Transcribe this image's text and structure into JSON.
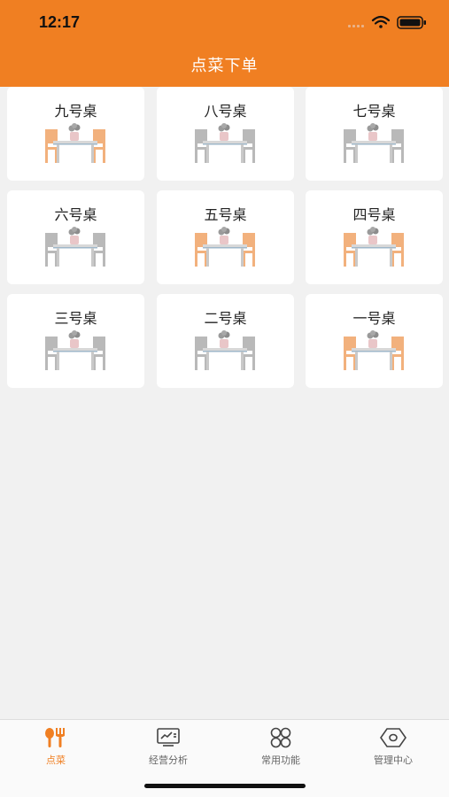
{
  "status": {
    "time": "12:17"
  },
  "header": {
    "title": "点菜下单"
  },
  "tables": [
    {
      "label": "九号桌",
      "occupied": true
    },
    {
      "label": "八号桌",
      "occupied": false
    },
    {
      "label": "七号桌",
      "occupied": false
    },
    {
      "label": "六号桌",
      "occupied": false
    },
    {
      "label": "五号桌",
      "occupied": true
    },
    {
      "label": "四号桌",
      "occupied": true
    },
    {
      "label": "三号桌",
      "occupied": false
    },
    {
      "label": "二号桌",
      "occupied": false
    },
    {
      "label": "一号桌",
      "occupied": true
    }
  ],
  "tabbar": {
    "items": [
      {
        "label": "点菜",
        "icon": "fork-spoon-icon",
        "active": true
      },
      {
        "label": "经营分析",
        "icon": "chart-monitor-icon",
        "active": false
      },
      {
        "label": "常用功能",
        "icon": "function-grid-icon",
        "active": false
      },
      {
        "label": "管理中心",
        "icon": "management-hexagon-icon",
        "active": false
      }
    ]
  },
  "colors": {
    "accent": "#f07f22",
    "occupied_chair": "#f2b17d",
    "free_chair": "#b9b9b9"
  }
}
